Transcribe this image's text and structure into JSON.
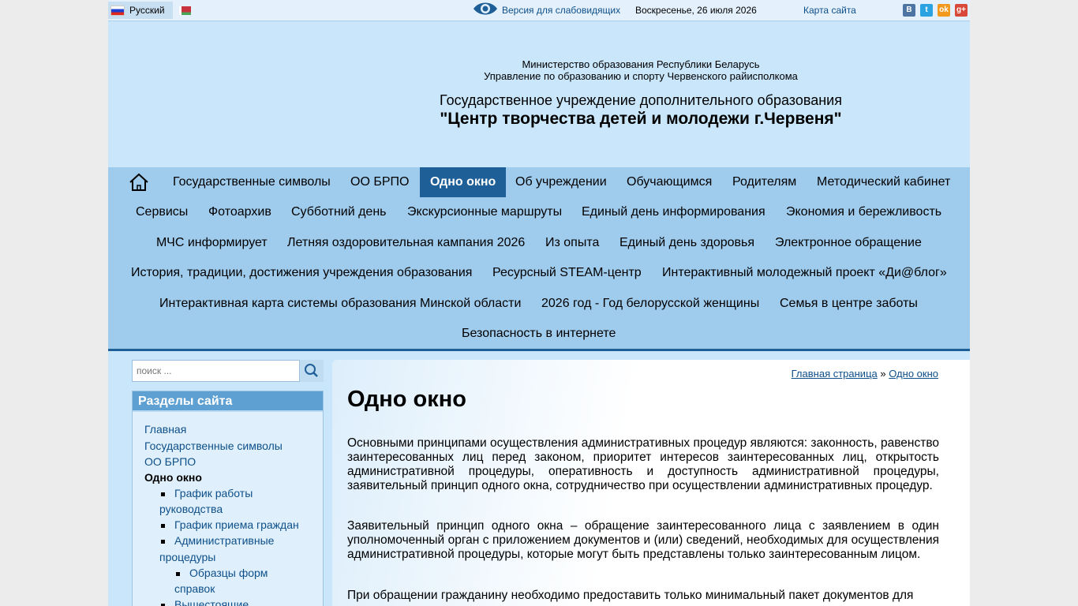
{
  "topbar": {
    "lang_ru": "Русский",
    "low_vision": "Версия для слабовидящих",
    "date": "Воскресенье, 26 июля 2026",
    "sitemap": "Карта сайта",
    "social": [
      "В",
      "t",
      "ok",
      "g+"
    ]
  },
  "header": {
    "line1": "Министерство образования Республики Беларусь",
    "line2": "Управление по образованию и спорту Червенского райисполкома",
    "line3": "Государственное учреждение дополнительного образования",
    "line4": "\"Центр творчества детей и молодежи г.Червеня\""
  },
  "nav": {
    "home_icon": "home-icon",
    "items": [
      "Государственные символы",
      "ОО БРПО",
      "Одно окно",
      "Об учреждении",
      "Обучающимся",
      "Родителям",
      "Методический кабинет",
      "Сервисы",
      "Фотоархив",
      "Субботний день",
      "Экскурсионные маршруты",
      "Единый день информирования",
      "Экономия и бережливость",
      "МЧС информирует",
      "Летняя оздоровительная кампания 2026",
      "Из опыта",
      "Единый день здоровья",
      "Электронное обращение",
      "История, традиции, достижения учреждения образования",
      "Ресурсный STEAM-центр",
      "Интерактивный молодежный проект «Ди@блог»",
      "Интерактивная карта системы образования Минской области",
      "2026 год - Год белорусской женщины",
      "Семья в центре заботы",
      "Безопасность в интернете"
    ]
  },
  "search": {
    "placeholder": "поиск ..."
  },
  "sidebar": {
    "title": "Разделы сайта",
    "items": [
      "Главная",
      "Государственные символы",
      "ОО БРПО",
      "Одно окно",
      "График работы",
      "руководства",
      "График приема граждан",
      "Административные",
      "процедуры",
      "Образцы форм",
      "справок",
      "Вышестоящие"
    ]
  },
  "content": {
    "breadcrumb_home": "Главная страница",
    "breadcrumb_sep": "»",
    "breadcrumb_current": "Одно окно",
    "title": "Одно окно",
    "p1": "Основными принципами осуществления административных процедур являются: законность, равенство заинтересованных лиц перед законом, приоритет интересов заинтересованных лиц, открытость административной процедуры, оперативность и доступность административной процедуры, заявительный принцип одного окна, сотрудничество при осуществлении административных процедур.",
    "p2": "Заявительный принцип одного окна – обращение заинтересованного лица с заявлением в один уполномоченный орган с приложением документов и (или) сведений, необходимых для осуществления административной процедуры, которые могут быть представлены только заинтересованным лицом.",
    "p3": "При обращении гражданину необходимо предоставить только минимальный пакет документов для"
  }
}
